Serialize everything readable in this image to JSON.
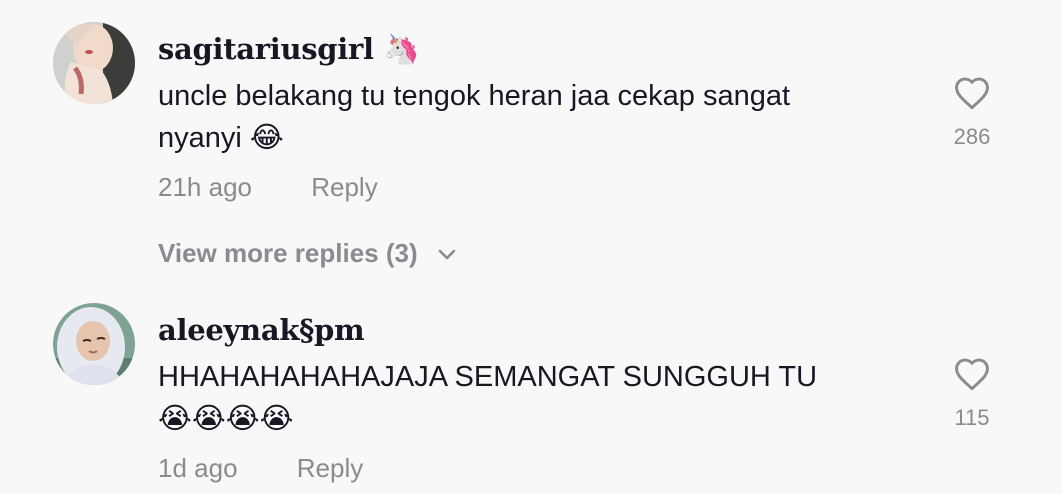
{
  "comments": [
    {
      "username": "sagitariusgirl",
      "username_emoji": "🦄",
      "text_line1": "uncle belakang tu tengok heran jaa cekap sangat",
      "text_line2": "nyanyi",
      "text_emoji": "😂",
      "time": "21h ago",
      "reply_label": "Reply",
      "likes": "286"
    },
    {
      "username": "aleeynak§pm",
      "text_line1": "HHAHAHAHAHAJAJA SEMANGAT SUNGGUH TU",
      "text_emoji": "😭😭😭😭",
      "time": "1d ago",
      "reply_label": "Reply",
      "likes": "115"
    }
  ],
  "view_more": "View more replies (3)",
  "colors": {
    "background": "#f8f8f8",
    "text": "#161823",
    "muted": "#8a8b91"
  },
  "icons": {
    "heart": "heart-outline-icon",
    "chevron": "chevron-down-icon"
  }
}
